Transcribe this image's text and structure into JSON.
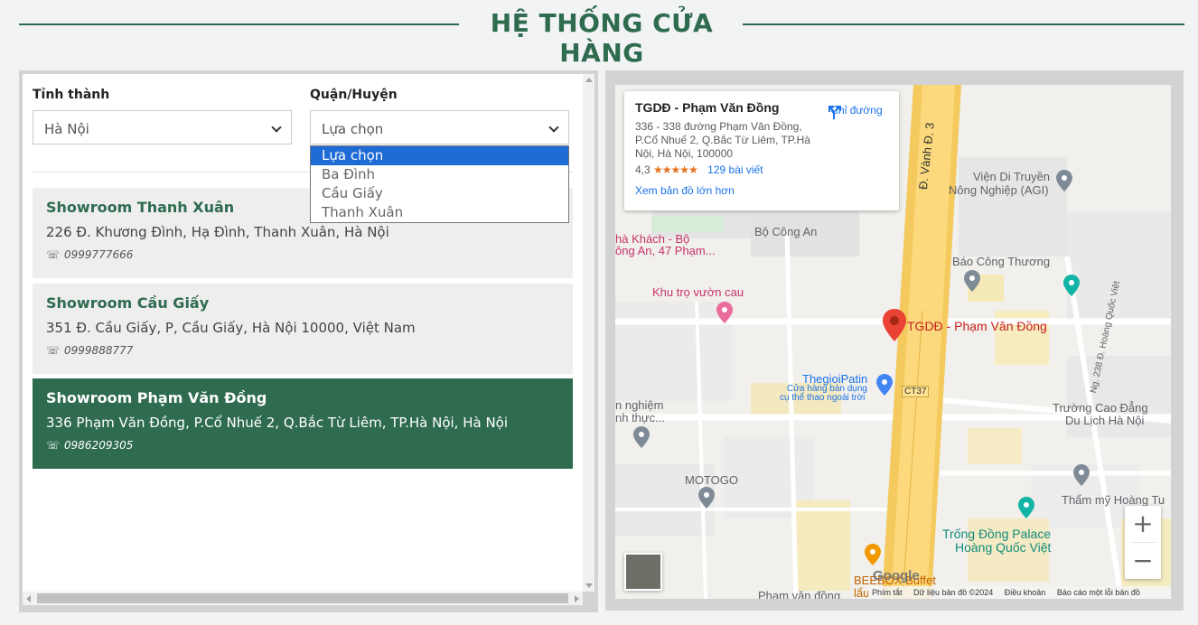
{
  "heading": {
    "title": "HỆ THỐNG CỬA HÀNG"
  },
  "filters": {
    "province_label": "Tỉnh thành",
    "province_value": "Hà Nội",
    "district_label": "Quận/Huyện",
    "district_value": "Lựa chọn",
    "district_options": [
      "Lựa chọn",
      "Ba Đình",
      "Cầu Giấy",
      "Thanh Xuân"
    ]
  },
  "stores": [
    {
      "name": "Showroom Thanh Xuân",
      "address": "226 Đ. Khương Đình, Hạ Đình, Thanh Xuân, Hà Nội",
      "phone": "0999777666",
      "active": false
    },
    {
      "name": "Showroom Cầu Giấy",
      "address": "351 Đ. Cầu Giấy, P, Cầu Giấy, Hà Nội 10000, Việt Nam",
      "phone": "0999888777",
      "active": false
    },
    {
      "name": "Showroom Phạm Văn Đồng",
      "address": "336 Phạm Văn Đồng, P.Cổ Nhuế 2, Q.Bắc Từ Liêm, TP.Hà Nội, Hà Nội",
      "phone": "0986209305",
      "active": true
    }
  ],
  "phone_icon": "☏",
  "map": {
    "card": {
      "title": "TGDĐ - Phạm Văn Đồng",
      "address": "336 - 338 đường Phạm Văn Đồng, P.Cổ Nhuế 2, Q.Bắc Từ Liêm, TP.Hà Nội, Hà Nội, 100000",
      "rating": "4,3",
      "stars": "★★★★★",
      "reviews": "129 bài viết",
      "larger_map": "Xem bản đồ lớn hơn",
      "directions": "Chỉ đường"
    },
    "labels": {
      "vanh_dai": "Đ. Vành Đ. 3",
      "vien": "Viện Di Truyền",
      "vien2": "Nông Nghiệp (AGI)",
      "bo_cong_an": "Bộ Công An",
      "nha_khach": "hà Khách - Bộ",
      "nha_khach2": "ông An, 47 Phạm...",
      "bao_cong_thuong": "Báo Công Thương",
      "khu_tro": "Khu trọ vườn cau",
      "pin_label": "TGDĐ - Phạm Văn Đồng",
      "thegioipatin": "ThegioiPatin",
      "thegioipatin_sub": "Cửa hàng bán dụng",
      "thegioipatin_sub2": "cụ thể thao ngoài trời",
      "ct37": "CT37",
      "ng238": "Ng. 238 Đ. Hoàng Quốc Việt",
      "nghiem": "n nghiệm",
      "nghiem2": "nh thực...",
      "truong": "Trường Cao Đẳng",
      "truong2": "Du Lịch Hà Nội",
      "motogo": "MOTOGO",
      "tham_my": "Thẩm mỹ Hoàng Tu",
      "trong_dong": "Trống Đồng Palace",
      "trong_dong2": "Hoàng Quốc Việt",
      "beebox": "BEEBOX Buffet",
      "lau": "lẩu",
      "pham_van_dong": "Phạm văn đồng"
    },
    "google_logo": "Google",
    "footer": [
      "Phím tắt",
      "Dữ liệu bản đồ ©2024",
      "Điều khoản",
      "Báo cáo một lỗi bản đồ"
    ],
    "zoom_in": "+",
    "zoom_out": "−"
  },
  "colors": {
    "brand": "#2e6b4f",
    "select_highlight": "#1f6bd6"
  }
}
